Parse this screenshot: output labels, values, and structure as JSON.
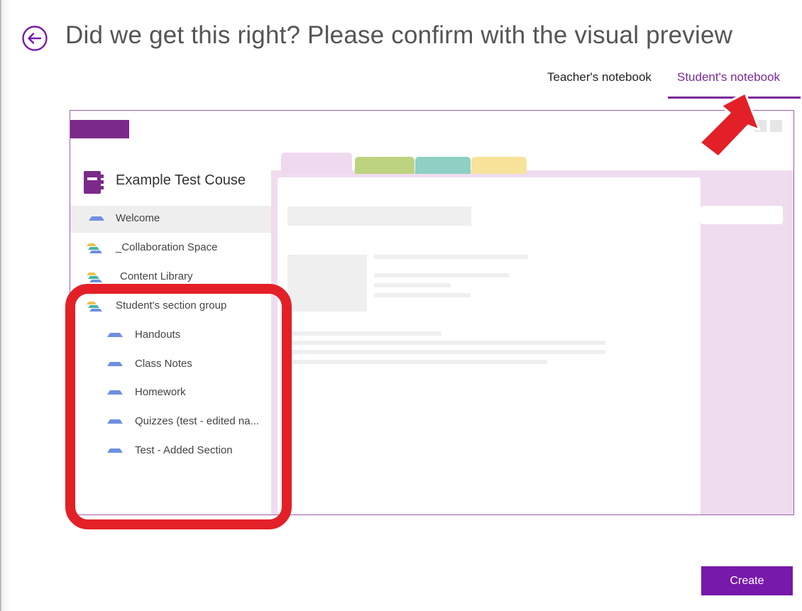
{
  "header": {
    "title": "Did we get this right? Please confirm with the visual preview"
  },
  "tabs": [
    {
      "label": "Teacher's notebook",
      "selected": false
    },
    {
      "label": "Student's notebook",
      "selected": true
    }
  ],
  "preview": {
    "notebook_title": "Example Test Couse",
    "sections": [
      {
        "label": "Welcome",
        "icon": "section-icon",
        "selected": true
      },
      {
        "label": "_Collaboration Space",
        "icon": "section-group-icon"
      },
      {
        "label": "Content Library",
        "icon": "section-group-icon"
      },
      {
        "label": "Student's section group",
        "icon": "section-group-icon"
      },
      {
        "label": "Handouts",
        "icon": "section-icon"
      },
      {
        "label": "Class Notes",
        "icon": "section-icon"
      },
      {
        "label": "Homework",
        "icon": "section-icon"
      },
      {
        "label": "Quizzes (test - edited na...",
        "icon": "section-icon"
      },
      {
        "label": "Test - Added Section",
        "icon": "section-icon"
      }
    ]
  },
  "actions": {
    "create_label": "Create"
  },
  "colors": {
    "accent": "#7719aa",
    "tab_active": "#7a2a99",
    "annotation": "#e32027",
    "section_blue": "#6f8fe0"
  }
}
